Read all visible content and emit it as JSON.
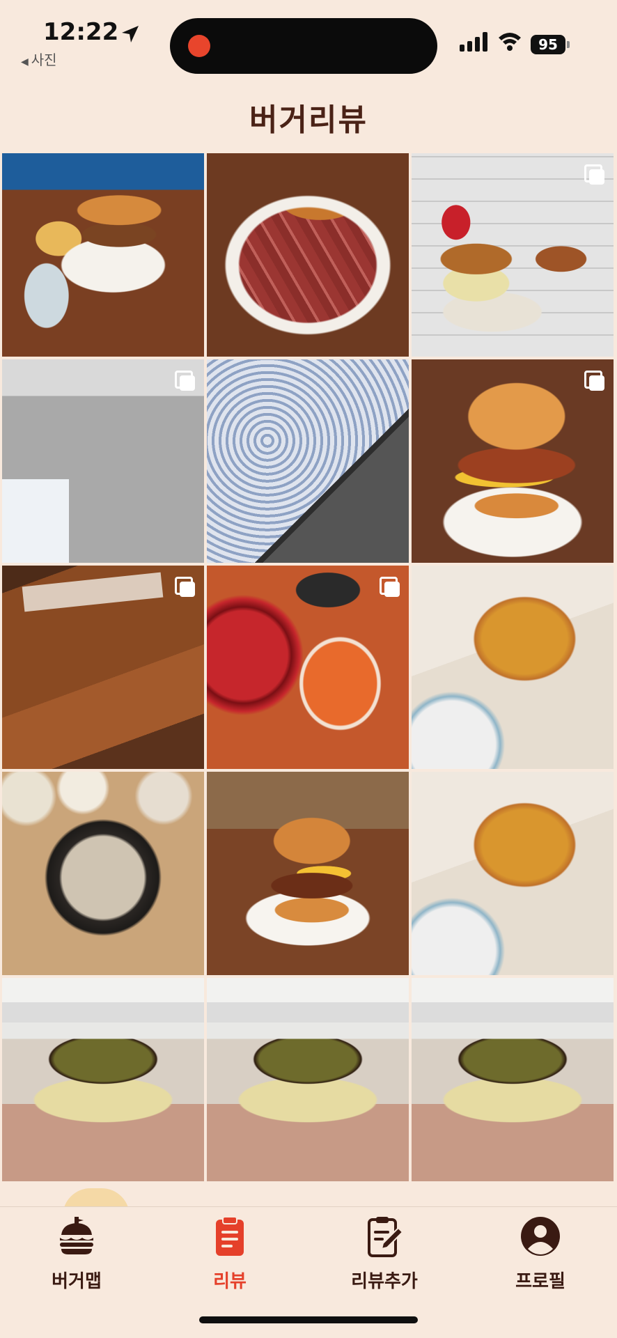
{
  "status_bar": {
    "time": "12:22",
    "back_app": "사진",
    "battery": "95"
  },
  "header": {
    "title": "버거리뷰"
  },
  "grid": {
    "photos": [
      {
        "subject": "burger-fries",
        "multi": false
      },
      {
        "subject": "steak-burger",
        "multi": false
      },
      {
        "subject": "burger-cola",
        "multi": true
      },
      {
        "subject": "floor",
        "multi": true
      },
      {
        "subject": "sky",
        "multi": false
      },
      {
        "subject": "big-burger",
        "multi": true
      },
      {
        "subject": "wood-table",
        "multi": true
      },
      {
        "subject": "pasta",
        "multi": true
      },
      {
        "subject": "pizza",
        "multi": false
      },
      {
        "subject": "samgyetang",
        "multi": false
      },
      {
        "subject": "burger-plate",
        "multi": false
      },
      {
        "subject": "pizza",
        "multi": false
      },
      {
        "subject": "mochi-bread",
        "multi": false
      },
      {
        "subject": "mochi-bread",
        "multi": false
      },
      {
        "subject": "mochi-bread",
        "multi": false
      }
    ]
  },
  "tabbar": {
    "items": [
      {
        "label": "버거맵",
        "icon": "burger-icon",
        "active": false
      },
      {
        "label": "리뷰",
        "icon": "clipboard-icon",
        "active": true
      },
      {
        "label": "리뷰추가",
        "icon": "edit-note-icon",
        "active": false
      },
      {
        "label": "프로필",
        "icon": "profile-icon",
        "active": false
      }
    ]
  },
  "colors": {
    "accent": "#e5402a",
    "background": "#f8e9dd",
    "title": "#4a2216"
  }
}
